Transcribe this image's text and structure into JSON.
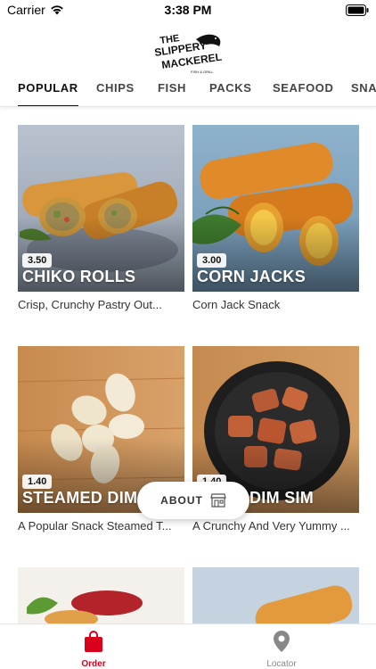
{
  "status_bar": {
    "carrier": "Carrier",
    "time": "3:38 PM"
  },
  "logo": {
    "line1": "THE",
    "line2": "SLIPPERY",
    "line3": "MACKEREL",
    "tagline": "FISH & GRILL"
  },
  "tabs": [
    {
      "label": "POPULAR",
      "active": true
    },
    {
      "label": "CHIPS"
    },
    {
      "label": "FISH"
    },
    {
      "label": "PACKS"
    },
    {
      "label": "SEAFOOD"
    },
    {
      "label": "SNAC"
    }
  ],
  "products": [
    {
      "name": "CHIKO ROLLS",
      "price": "3.50",
      "description": "Crisp, Crunchy Pastry Out..."
    },
    {
      "name": "CORN JACKS",
      "price": "3.00",
      "description": "Corn Jack Snack"
    },
    {
      "name": "STEAMED DIM",
      "price": "1.40",
      "description": "A Popular Snack Steamed T..."
    },
    {
      "name": "DIM SIM",
      "price": "1.40",
      "description": "A Crunchy And Very Yummy ..."
    }
  ],
  "about_button": {
    "label": "ABOUT",
    "icon": "store-icon"
  },
  "bottom_nav": {
    "order": {
      "label": "Order",
      "icon": "shopping-bag-icon",
      "color": "#d9001b"
    },
    "locator": {
      "label": "Locator",
      "icon": "map-pin-icon",
      "color": "#888888"
    }
  },
  "colors": {
    "accent": "#d9001b",
    "text": "#222222"
  }
}
